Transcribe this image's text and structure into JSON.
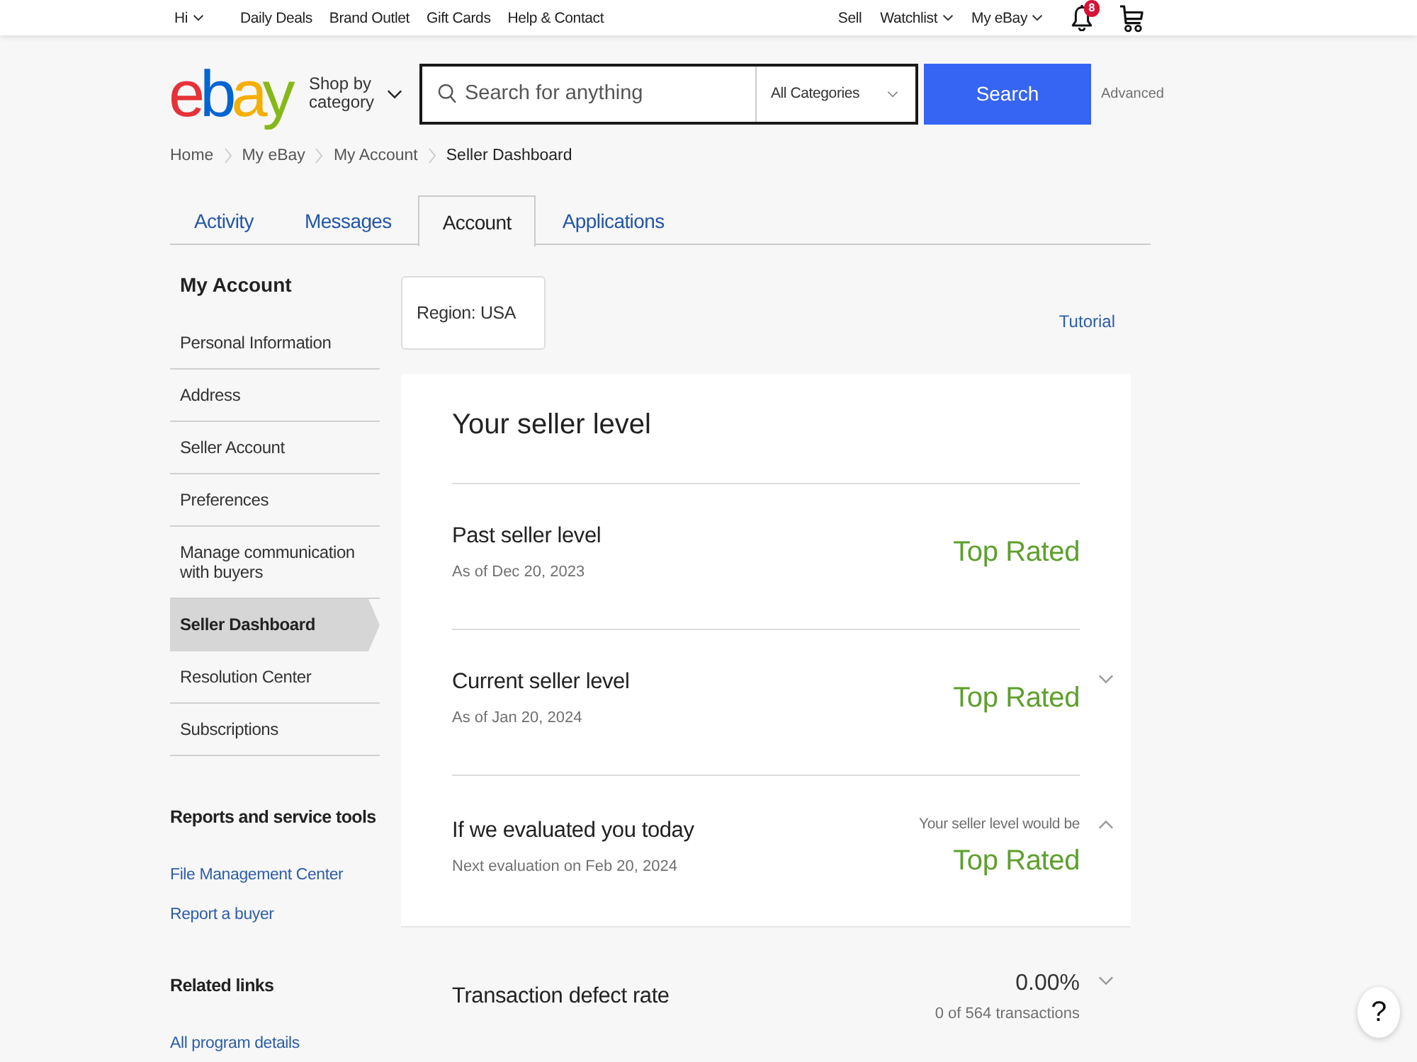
{
  "top_nav": {
    "greeting": "Hi",
    "links": [
      "Daily Deals",
      "Brand Outlet",
      "Gift Cards",
      "Help & Contact"
    ],
    "right_links": [
      {
        "label": "Sell",
        "dropdown": false
      },
      {
        "label": "Watchlist",
        "dropdown": true
      },
      {
        "label": "My eBay",
        "dropdown": true
      }
    ],
    "notification_count": "8"
  },
  "header": {
    "logo": "ebay",
    "shop_by_category": "Shop by category",
    "search": {
      "placeholder": "Search for anything",
      "category": "All Categories",
      "button": "Search"
    },
    "advanced": "Advanced"
  },
  "breadcrumb": {
    "links": [
      "Home",
      "My eBay",
      "My Account"
    ],
    "current": "Seller Dashboard"
  },
  "tabs": [
    {
      "label": "Activity",
      "selected": false
    },
    {
      "label": "Messages",
      "selected": false
    },
    {
      "label": "Account",
      "selected": true
    },
    {
      "label": "Applications",
      "selected": false
    }
  ],
  "sidebar": {
    "title": "My Account",
    "items": [
      {
        "label": "Personal Information",
        "selected": false
      },
      {
        "label": "Address",
        "selected": false
      },
      {
        "label": "Seller Account",
        "selected": false
      },
      {
        "label": "Preferences",
        "selected": false
      },
      {
        "label": "Manage communication with buyers",
        "selected": false
      },
      {
        "label": "Seller Dashboard",
        "selected": true
      },
      {
        "label": "Resolution Center",
        "selected": false
      },
      {
        "label": "Subscriptions",
        "selected": false
      }
    ],
    "sections": [
      {
        "title": "Reports and service tools",
        "links": [
          "File Management Center",
          "Report a buyer"
        ]
      },
      {
        "title": "Related links",
        "links": [
          "All program details"
        ]
      }
    ]
  },
  "main": {
    "region": "Region: USA",
    "tutorial": "Tutorial",
    "seller_level": {
      "title": "Your seller level",
      "rows": [
        {
          "label": "Past seller level",
          "date": "As of Dec 20, 2023",
          "rating": "Top Rated"
        },
        {
          "label": "Current seller level",
          "date": "As of Jan 20, 2024",
          "rating": "Top Rated",
          "expanded": false
        },
        {
          "label": "If we evaluated you today",
          "date": "Next evaluation on Feb 20, 2024",
          "note": "Your seller level would be",
          "rating": "Top Rated",
          "expanded": true
        }
      ]
    },
    "transaction_defect_rate": {
      "label": "Transaction defect rate",
      "value": "0.00%",
      "detail": "0 of 564 transactions",
      "expanded": false
    }
  },
  "help_button": "?"
}
